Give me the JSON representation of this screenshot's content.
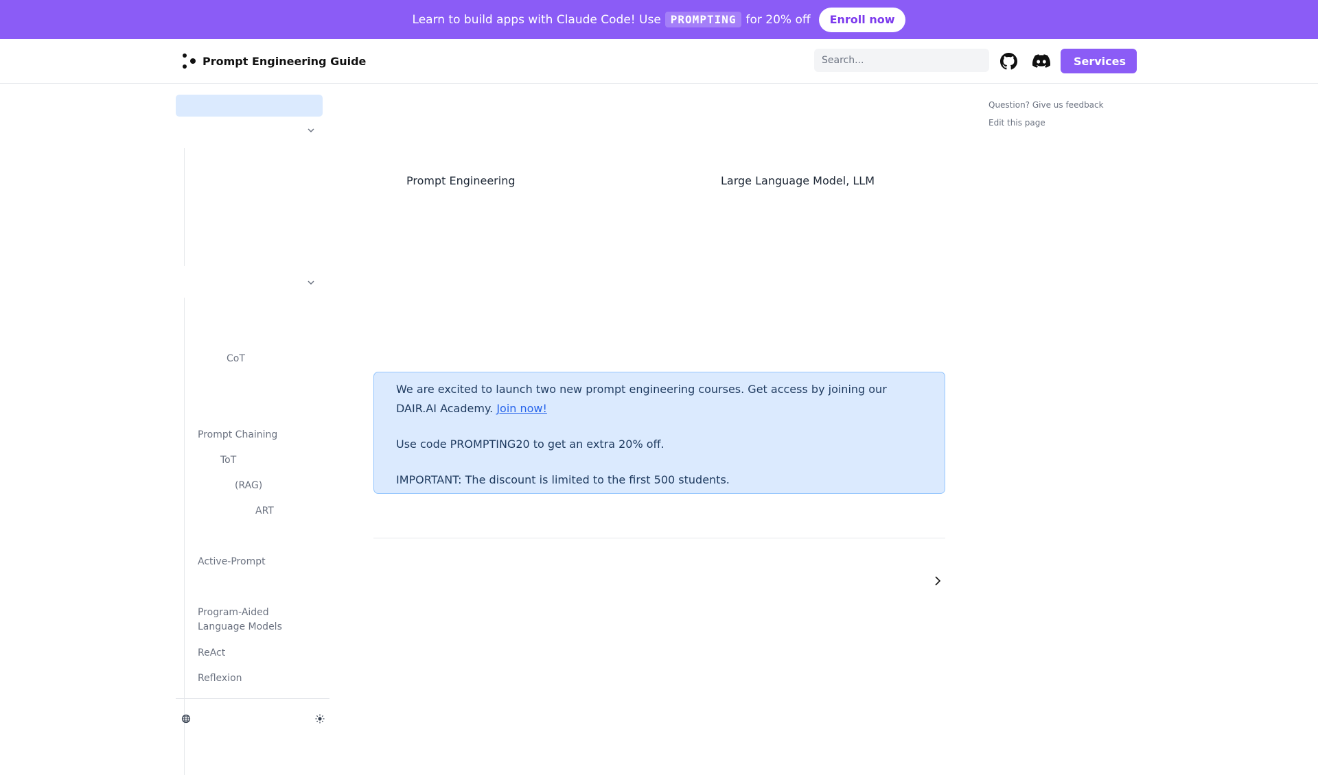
{
  "banner": {
    "text_before": "Learn to build apps with Claude Code! Use",
    "code": "PROMPTING",
    "text_after": "for 20% off",
    "cta": "Enroll now"
  },
  "header": {
    "title": "Prompt Engineering Guide",
    "search_placeholder": "Search...",
    "services_label": "Services",
    "icons": [
      "logo-icon",
      "github-icon",
      "discord-icon"
    ]
  },
  "sidebar": {
    "items": [
      {
        "label": "CoT"
      },
      {
        "label": "Prompt Chaining"
      },
      {
        "label": "ToT"
      },
      {
        "label": "(RAG)"
      },
      {
        "label": "ART"
      },
      {
        "label": "Active-Prompt"
      },
      {
        "label": "Program-Aided Language Models"
      },
      {
        "label": "ReAct"
      },
      {
        "label": "Reflexion"
      }
    ],
    "icons": [
      "chevron-down-icon",
      "globe-icon",
      "sun-icon"
    ]
  },
  "main": {
    "term_left": "Prompt Engineering",
    "term_right": "Large Language Model, LLM",
    "callout": {
      "line1_before": "We are excited to launch two new prompt engineering courses. Get access by joining our DAIR.AI Academy.",
      "link": "Join now!",
      "line2": "Use code PROMPTING20 to get an extra 20% off.",
      "line3": "IMPORTANT: The discount is limited to the first 500 students."
    }
  },
  "toc": {
    "feedback": "Question? Give us feedback",
    "edit": "Edit this page"
  },
  "colors": {
    "brand": "#8b5cf6",
    "callout_bg": "#dbeafe",
    "link": "#2563eb"
  }
}
